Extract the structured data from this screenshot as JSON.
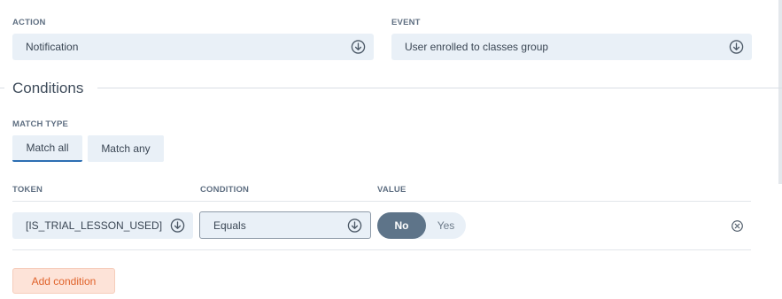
{
  "action": {
    "label": "ACTION",
    "value": "Notification"
  },
  "event": {
    "label": "EVENT",
    "value": "User enrolled to classes group"
  },
  "conditions": {
    "title": "Conditions",
    "match_type": {
      "label": "MATCH TYPE",
      "options": [
        "Match all",
        "Match any"
      ],
      "selected": "Match all"
    },
    "columns": {
      "token": "TOKEN",
      "condition": "CONDITION",
      "value": "VALUE"
    },
    "rows": [
      {
        "token": "[IS_TRIAL_LESSON_USED]",
        "condition": "Equals",
        "value_options": [
          "No",
          "Yes"
        ],
        "value_selected": "No"
      }
    ],
    "add_label": "Add condition"
  },
  "icons": {
    "dropdown": "chevron-down-circle-icon",
    "remove": "close-circle-icon"
  },
  "colors": {
    "accent": "#2d6fb3",
    "toggle_active": "#5e7489",
    "add_button": "#e0622a"
  }
}
